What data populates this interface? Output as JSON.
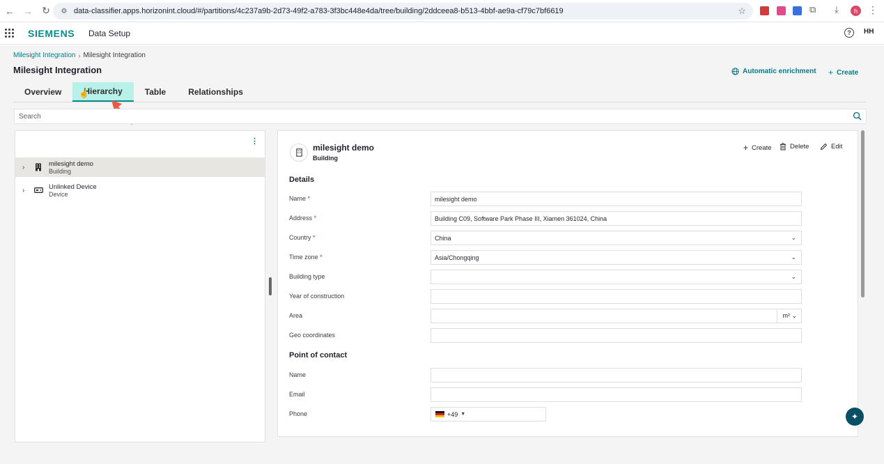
{
  "browser": {
    "url": "data-classifier.apps.horizonint.cloud/#/partitions/4c237a9b-2d73-49f2-a783-3f3bc448e4da/tree/building/2ddceea8-b513-4bbf-ae9a-cf79c7bf6619",
    "profile_initial": "h"
  },
  "app": {
    "brand": "SIEMENS",
    "title": "Data Setup",
    "user_initials": "HH"
  },
  "breadcrumb": {
    "parent": "Milesight Integration",
    "current": "Milesight Integration"
  },
  "page": {
    "title": "Milesight Integration",
    "automatic_enrichment": "Automatic enrichment",
    "create": "Create"
  },
  "tabs": [
    {
      "label": "Overview"
    },
    {
      "label": "Hierarchy",
      "active": true
    },
    {
      "label": "Table"
    },
    {
      "label": "Relationships"
    }
  ],
  "search": {
    "placeholder": "Search"
  },
  "tree": [
    {
      "name": "milesight demo",
      "type": "Building",
      "icon": "building-icon",
      "selected": true
    },
    {
      "name": "Unlinked Device",
      "type": "Device",
      "icon": "device-icon",
      "selected": false
    }
  ],
  "entity": {
    "name": "milesight demo",
    "type": "Building",
    "actions": {
      "create": "Create",
      "delete": "Delete",
      "edit": "Edit"
    }
  },
  "details": {
    "title": "Details",
    "fields": [
      {
        "label": "Name",
        "required": true,
        "value": "milesight demo",
        "kind": "text"
      },
      {
        "label": "Address",
        "required": true,
        "value": "Building C09, Software Park Phase III, Xiamen 361024, China",
        "kind": "text"
      },
      {
        "label": "Country",
        "required": true,
        "value": "China",
        "kind": "select"
      },
      {
        "label": "Time zone",
        "required": true,
        "value": "Asia/Chongqing",
        "kind": "select"
      },
      {
        "label": "Building type",
        "required": false,
        "value": "",
        "kind": "select"
      },
      {
        "label": "Year of construction",
        "required": false,
        "value": "",
        "kind": "text"
      },
      {
        "label": "Area",
        "required": false,
        "value": "",
        "kind": "unit",
        "unit": "m²"
      },
      {
        "label": "Geo coordinates",
        "required": false,
        "value": "",
        "kind": "text"
      }
    ]
  },
  "contact": {
    "title": "Point of contact",
    "name_label": "Name",
    "email_label": "Email",
    "phone_label": "Phone",
    "phone_code": "+49"
  },
  "colors": {
    "accent": "#0a8c8c",
    "tab_active_bg": "#b8f1ea",
    "required": "#c0362c",
    "annotation_arrow": "#e85a45"
  }
}
